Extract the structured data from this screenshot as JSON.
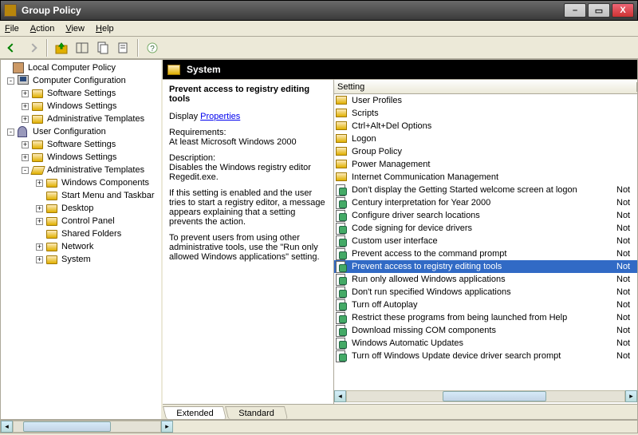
{
  "window": {
    "title": "Group Policy"
  },
  "menus": {
    "file": "File",
    "action": "Action",
    "view": "View",
    "help": "Help"
  },
  "tree": {
    "root": "Local Computer Policy",
    "computer": {
      "label": "Computer Configuration",
      "software": "Software Settings",
      "windows": "Windows Settings",
      "admin": "Administrative Templates"
    },
    "user": {
      "label": "User Configuration",
      "software": "Software Settings",
      "windows": "Windows Settings",
      "admin": {
        "label": "Administrative Templates",
        "wincomp": "Windows Components",
        "startmenu": "Start Menu and Taskbar",
        "desktop": "Desktop",
        "cpanel": "Control Panel",
        "shared": "Shared Folders",
        "network": "Network",
        "system": "System"
      }
    }
  },
  "header": {
    "title": "System"
  },
  "ext": {
    "title": "Prevent access to registry editing tools",
    "display": "Display",
    "properties_link": "Properties",
    "req_label": "Requirements:",
    "req_value": "At least Microsoft Windows 2000",
    "desc_label": "Description:",
    "desc_1": "Disables the Windows registry editor Regedit.exe.",
    "desc_2": "If this setting is enabled and the user tries to start a registry editor, a message appears explaining that a setting prevents the action.",
    "desc_3": "To prevent users from using other administrative tools, use the \"Run only allowed Windows applications\" setting."
  },
  "list": {
    "header": "Setting",
    "items": [
      {
        "type": "folder",
        "label": "User Profiles"
      },
      {
        "type": "folder",
        "label": "Scripts"
      },
      {
        "type": "folder",
        "label": "Ctrl+Alt+Del Options"
      },
      {
        "type": "folder",
        "label": "Logon"
      },
      {
        "type": "folder",
        "label": "Group Policy"
      },
      {
        "type": "folder",
        "label": "Power Management"
      },
      {
        "type": "folder",
        "label": "Internet Communication Management"
      },
      {
        "type": "policy",
        "label": "Don't display the Getting Started welcome screen at logon",
        "state": "Not"
      },
      {
        "type": "policy",
        "label": "Century interpretation for Year 2000",
        "state": "Not"
      },
      {
        "type": "policy",
        "label": "Configure driver search locations",
        "state": "Not"
      },
      {
        "type": "policy",
        "label": "Code signing for device drivers",
        "state": "Not"
      },
      {
        "type": "policy",
        "label": "Custom user interface",
        "state": "Not"
      },
      {
        "type": "policy",
        "label": "Prevent access to the command prompt",
        "state": "Not"
      },
      {
        "type": "policy",
        "label": "Prevent access to registry editing tools",
        "state": "Not",
        "selected": true
      },
      {
        "type": "policy",
        "label": "Run only allowed Windows applications",
        "state": "Not"
      },
      {
        "type": "policy",
        "label": "Don't run specified Windows applications",
        "state": "Not"
      },
      {
        "type": "policy",
        "label": "Turn off Autoplay",
        "state": "Not"
      },
      {
        "type": "policy",
        "label": "Restrict these programs from being launched from Help",
        "state": "Not"
      },
      {
        "type": "policy",
        "label": "Download missing COM components",
        "state": "Not"
      },
      {
        "type": "policy",
        "label": "Windows Automatic Updates",
        "state": "Not"
      },
      {
        "type": "policy",
        "label": "Turn off Windows Update device driver search prompt",
        "state": "Not"
      }
    ]
  },
  "tabs": {
    "extended": "Extended",
    "standard": "Standard"
  }
}
